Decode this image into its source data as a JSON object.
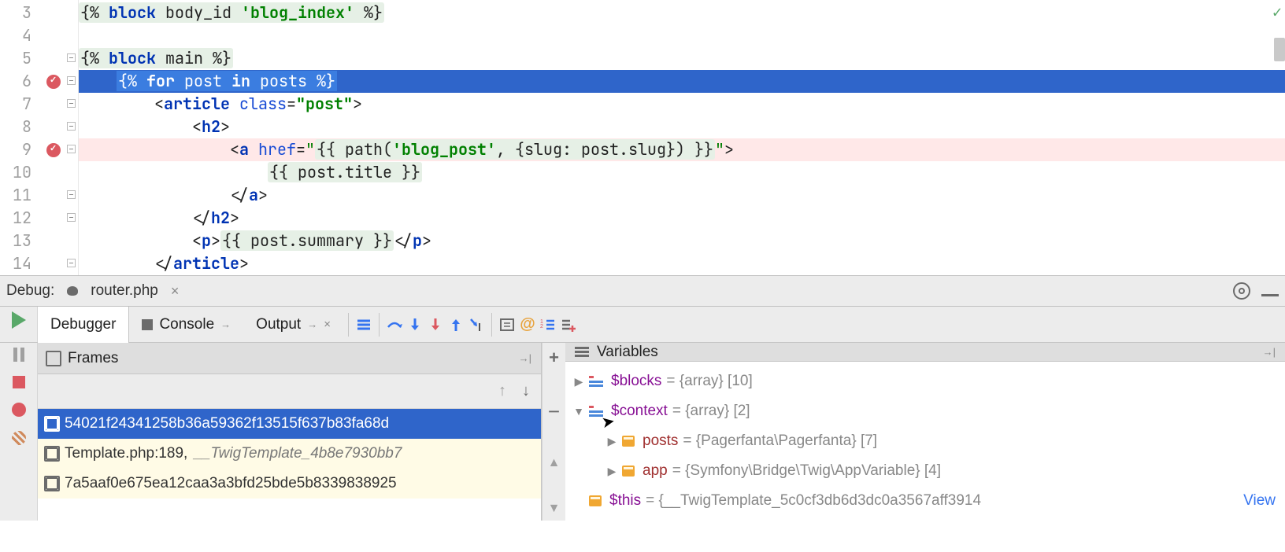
{
  "editor": {
    "lines": [
      {
        "num": "3",
        "bp": false,
        "fold": "",
        "type": "plain"
      },
      {
        "num": "4",
        "bp": false,
        "fold": "",
        "type": "empty"
      },
      {
        "num": "5",
        "bp": false,
        "fold": "minus",
        "type": "block_main"
      },
      {
        "num": "6",
        "bp": true,
        "fold": "minus",
        "type": "for_sel"
      },
      {
        "num": "7",
        "bp": false,
        "fold": "minus",
        "type": "article"
      },
      {
        "num": "8",
        "bp": false,
        "fold": "minus",
        "type": "h2open"
      },
      {
        "num": "9",
        "bp": true,
        "fold": "minus",
        "type": "a_href"
      },
      {
        "num": "10",
        "bp": false,
        "fold": "",
        "type": "title"
      },
      {
        "num": "11",
        "bp": false,
        "fold": "minus",
        "type": "a_close"
      },
      {
        "num": "12",
        "bp": false,
        "fold": "minus",
        "type": "h2close"
      },
      {
        "num": "13",
        "bp": false,
        "fold": "",
        "type": "summary"
      },
      {
        "num": "14",
        "bp": false,
        "fold": "minus",
        "type": "article_close"
      }
    ],
    "tokens": {
      "l3_open": "{%",
      "l3_kw": "block",
      "l3_rest": " body_id ",
      "l3_str": "'blog_index'",
      "l3_close": " %}",
      "l5_open": "{% ",
      "l5_kw": "block",
      "l5_rest": " main %}",
      "l6_open": "{% ",
      "l6_for": "for",
      "l6_mid": " post ",
      "l6_in": "in",
      "l6_end": " posts ",
      "l6_close": "%}",
      "l7": "<",
      "l7_tag": "article",
      "l7_sp": " ",
      "l7_attr": "class",
      "l7_eq": "=",
      "l7_str": "\"post\"",
      "l7_end": ">",
      "l8": "<",
      "l8_tag": "h2",
      "l8_end": ">",
      "l9": "<",
      "l9_tag": "a",
      "l9_sp": " ",
      "l9_attr": "href",
      "l9_eq": "=",
      "l9_q": "\"",
      "l9_exo": "{{ ",
      "l9_path": "path(",
      "l9_s1": "'blog_post'",
      "l9_mid": ", {slug: post.slug}) ",
      "l9_exc": "}}",
      "l9_qe": "\"",
      "l9_end": ">",
      "l10": "{{ post.title }}",
      "l11": "</",
      "l11_tag": "a",
      "l11_end": ">",
      "l12": "</",
      "l12_tag": "h2",
      "l12_end": ">",
      "l13_o": "<",
      "l13_tag": "p",
      "l13_c": ">",
      "l13_ex": "{{ post.summary }}",
      "l13_co": "</",
      "l13_ce": ">",
      "l14": "</",
      "l14_tag": "article",
      "l14_end": ">"
    }
  },
  "debug_bar": {
    "label": "Debug:",
    "tab": "router.php"
  },
  "debug_tabs": {
    "debugger": "Debugger",
    "console": "Console",
    "output": "Output"
  },
  "frames_panel": {
    "title": "Frames",
    "items": [
      {
        "sel": true,
        "text": "54021f24341258b36a59362f13515f637b83fa68d"
      },
      {
        "sel": false,
        "prefix": "Template.php:189, ",
        "italic": "__TwigTemplate_4b8e7930bb7"
      },
      {
        "sel": false,
        "text": "7a5aaf0e675ea12caa3a3bfd25bde5b8339838925"
      }
    ]
  },
  "variables_panel": {
    "title": "Variables",
    "items": [
      {
        "indent": 0,
        "expand": "▶",
        "ico": "num",
        "name": "$blocks",
        "val": " = {array} [10]"
      },
      {
        "indent": 0,
        "expand": "▼",
        "ico": "num",
        "name": "$context",
        "val": " = {array} [2]"
      },
      {
        "indent": 1,
        "expand": "▶",
        "ico": "obj",
        "name": "posts",
        "val": " = {Pagerfanta\\Pagerfanta} [7]"
      },
      {
        "indent": 1,
        "expand": "▶",
        "ico": "obj",
        "name": "app",
        "val": " = {Symfony\\Bridge\\Twig\\AppVariable} [4]"
      },
      {
        "indent": 0,
        "expand": "",
        "ico": "obj",
        "name": "$this",
        "val": " = {__TwigTemplate_5c0cf3db6d3dc0a3567aff3914",
        "view": "View"
      }
    ]
  }
}
